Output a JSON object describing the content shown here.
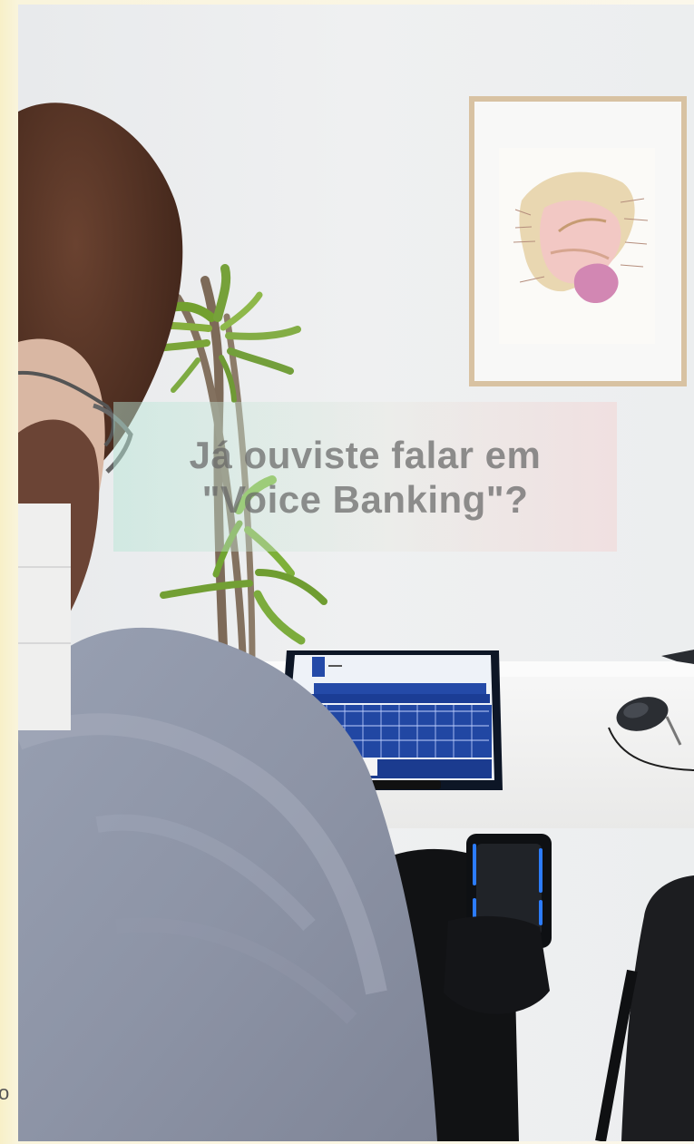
{
  "overlay": {
    "question_line1": "Já ouviste falar em",
    "question_line2": "\"Voice Banking\"?"
  },
  "side_label": "o",
  "scene": {
    "wall_color": "#eceef0",
    "desk_color": "#f2f2f2",
    "sweater_color": "#8a91a3",
    "hair_color": "#4a2d20",
    "tablet_key_color": "#1f3f98"
  },
  "icons": {
    "tablet": "tablet-icon",
    "mouse": "mouse-icon",
    "plant": "plant-icon",
    "framed_art": "framed-art-icon",
    "phone_holder": "phone-holder-icon",
    "chair": "chair-icon"
  }
}
